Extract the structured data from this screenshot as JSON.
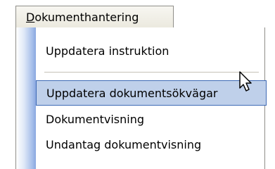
{
  "menubar": {
    "title": "Dokumenthantering",
    "title_mnemonic_char": "D",
    "title_rest": "okumenthantering"
  },
  "dropdown": {
    "items": [
      {
        "label": "Uppdatera instruktion",
        "selected": false
      },
      {
        "label": "Uppdatera dokumentsökvägar",
        "selected": true
      },
      {
        "label": "Dokumentvisning",
        "selected": false
      },
      {
        "label": "Undantag dokumentvisning",
        "selected": false
      }
    ]
  },
  "colors": {
    "selection_fill": "#bfd0ea",
    "selection_border": "#3e6ab5",
    "gutter_blue": "#8aa8e0",
    "border_gray": "#8f8e89"
  },
  "icons": [
    "mouse-cursor-icon"
  ]
}
